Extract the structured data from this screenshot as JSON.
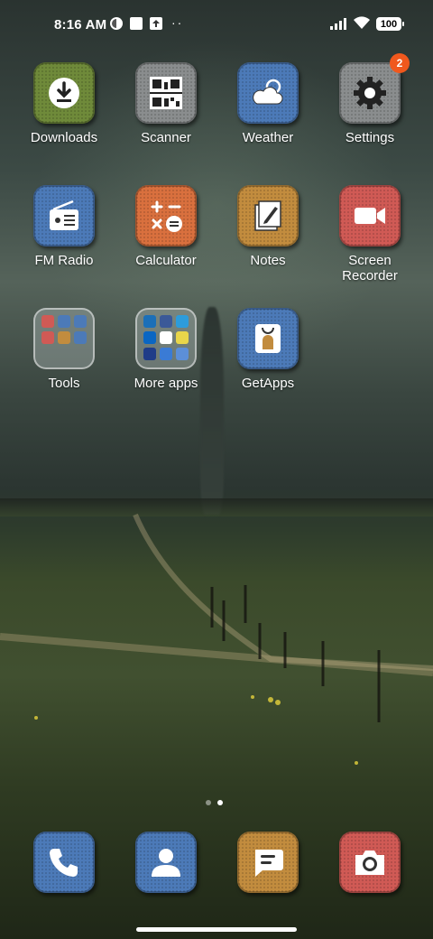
{
  "status_bar": {
    "time": "8:16 AM",
    "battery": "100",
    "dots": "··"
  },
  "apps": [
    {
      "label": "Downloads",
      "icon": "download-icon",
      "color": "#6f8a3a"
    },
    {
      "label": "Scanner",
      "icon": "qr-code-icon",
      "color": "#8a8d8e"
    },
    {
      "label": "Weather",
      "icon": "weather-icon",
      "color": "#4c7ab8"
    },
    {
      "label": "Settings",
      "icon": "gear-icon",
      "color": "#8a8d8e",
      "badge": "2"
    },
    {
      "label": "FM Radio",
      "icon": "radio-icon",
      "color": "#4c7ab8"
    },
    {
      "label": "Calculator",
      "icon": "calculator-icon",
      "color": "#d9703e"
    },
    {
      "label": "Notes",
      "icon": "notes-icon",
      "color": "#c28c3e"
    },
    {
      "label": "Screen\nRecorder",
      "icon": "video-camera-icon",
      "color": "#d05a55"
    },
    {
      "label": "Tools",
      "icon": "folder-icon"
    },
    {
      "label": "More apps",
      "icon": "folder-icon"
    },
    {
      "label": "GetApps",
      "icon": "shopping-bag-icon",
      "color": "#4c7ab8"
    }
  ],
  "dock": [
    {
      "icon": "phone-icon",
      "color": "#4c7ab8"
    },
    {
      "icon": "contacts-icon",
      "color": "#4c7ab8"
    },
    {
      "icon": "messages-icon",
      "color": "#c28c3e"
    },
    {
      "icon": "camera-icon",
      "color": "#d05a55"
    }
  ],
  "pager": {
    "pages": 2,
    "current": 2
  }
}
